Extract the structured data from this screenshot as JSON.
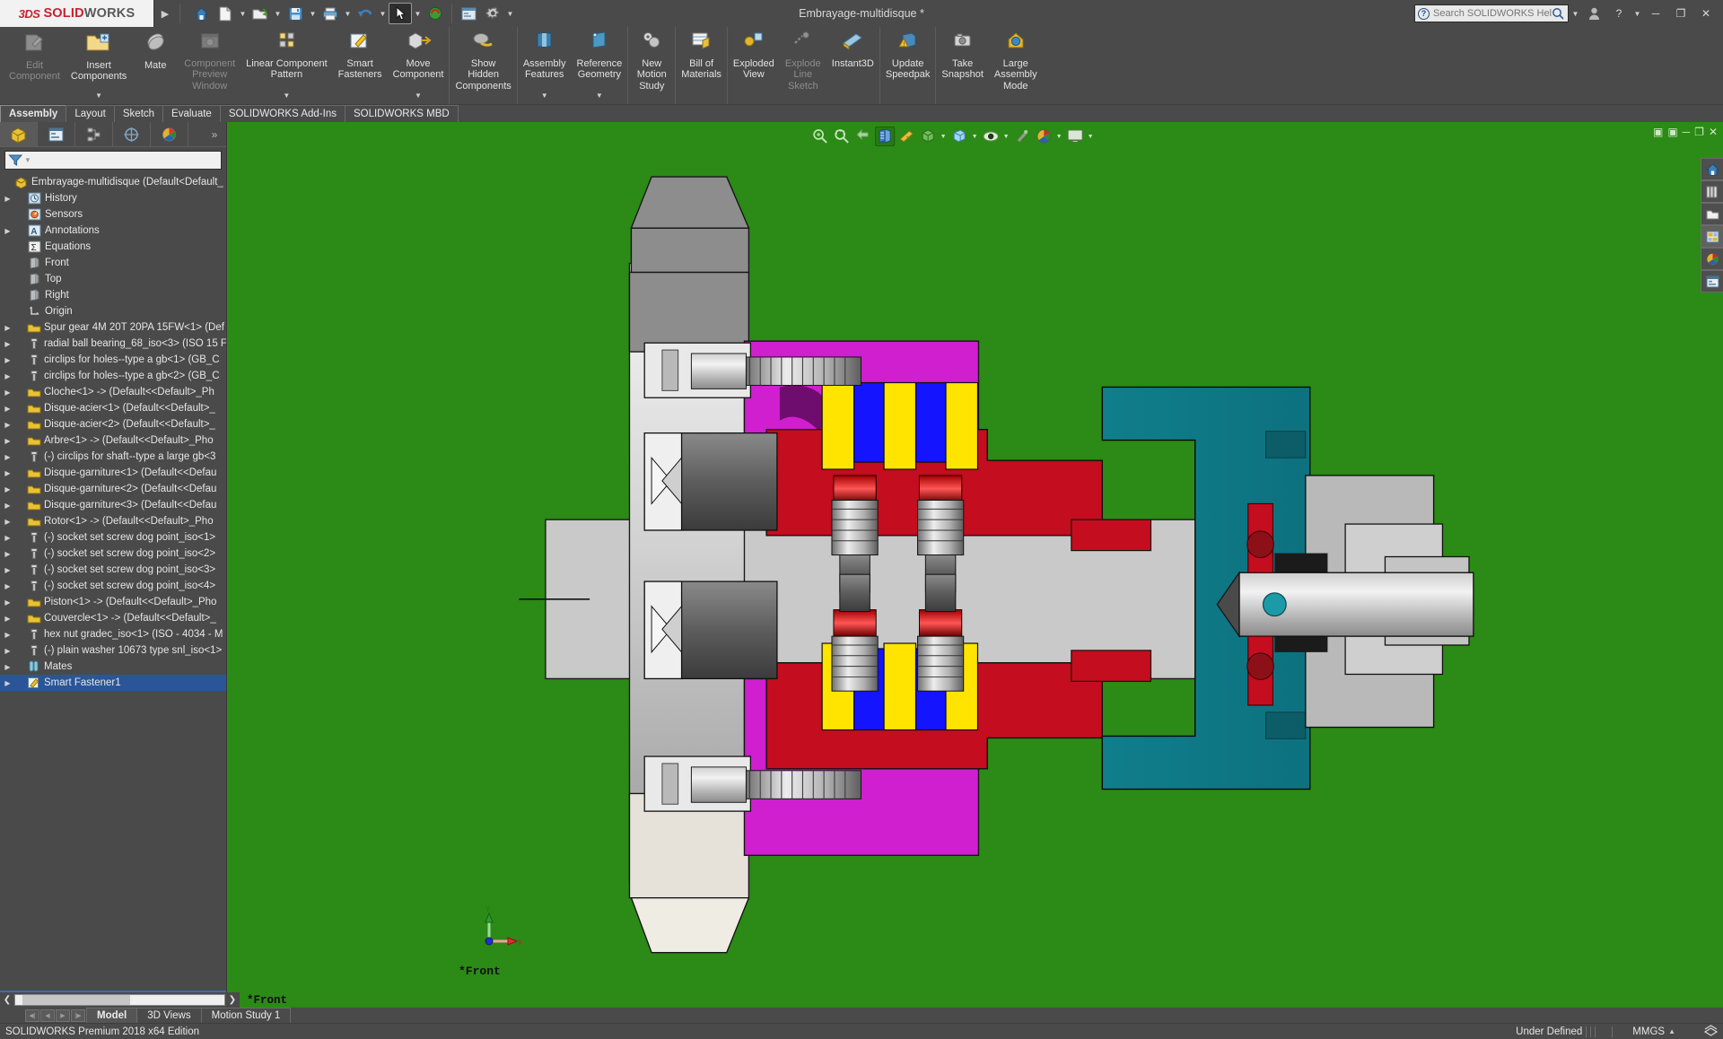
{
  "titlebar": {
    "logo_3ds": "3DS",
    "logo_solid": "SOLID",
    "logo_works": "WORKS",
    "document_title": "Embrayage-multidisque *",
    "search_placeholder": "Search SOLIDWORKS Help",
    "quick_access": [
      {
        "name": "home-icon",
        "label": "Home"
      },
      {
        "name": "new-document-icon",
        "label": "New"
      },
      {
        "name": "open-document-icon",
        "label": "Open"
      },
      {
        "name": "save-icon",
        "label": "Save"
      },
      {
        "name": "print-icon",
        "label": "Print"
      },
      {
        "name": "undo-icon",
        "label": "Undo"
      },
      {
        "name": "select-cursor-icon",
        "label": "Select"
      },
      {
        "name": "rebuild-icon",
        "label": "Rebuild"
      },
      {
        "name": "options-window-icon",
        "label": "Options Window"
      },
      {
        "name": "settings-gear-icon",
        "label": "Options"
      }
    ],
    "window_controls": [
      {
        "name": "user-account-icon",
        "glyph": "●"
      },
      {
        "name": "help-icon",
        "glyph": "?"
      },
      {
        "name": "minimize-icon",
        "glyph": "—"
      },
      {
        "name": "restore-icon",
        "glyph": "❐"
      },
      {
        "name": "close-icon",
        "glyph": "✕"
      }
    ]
  },
  "ribbon": {
    "groups": [
      {
        "buttons": [
          {
            "label": "Edit\nComponent",
            "icon": "edit-component-icon",
            "disabled": true,
            "caret": false
          },
          {
            "label": "Insert\nComponents",
            "icon": "insert-components-icon",
            "disabled": false,
            "caret": true
          },
          {
            "label": "Mate",
            "icon": "mate-icon",
            "disabled": false,
            "caret": false
          },
          {
            "label": "Component\nPreview\nWindow",
            "icon": "component-preview-window-icon",
            "disabled": true,
            "caret": false
          },
          {
            "label": "Linear Component\nPattern",
            "icon": "linear-component-pattern-icon",
            "disabled": false,
            "caret": true
          },
          {
            "label": "Smart\nFasteners",
            "icon": "smart-fasteners-icon",
            "disabled": false,
            "caret": false
          },
          {
            "label": "Move\nComponent",
            "icon": "move-component-icon",
            "disabled": false,
            "caret": true
          }
        ]
      },
      {
        "buttons": [
          {
            "label": "Show\nHidden\nComponents",
            "icon": "show-hidden-components-icon",
            "disabled": false,
            "caret": false
          }
        ]
      },
      {
        "buttons": [
          {
            "label": "Assembly\nFeatures",
            "icon": "assembly-features-icon",
            "disabled": false,
            "caret": true
          },
          {
            "label": "Reference\nGeometry",
            "icon": "reference-geometry-icon",
            "disabled": false,
            "caret": true
          }
        ]
      },
      {
        "buttons": [
          {
            "label": "New\nMotion\nStudy",
            "icon": "new-motion-study-icon",
            "disabled": false,
            "caret": false
          }
        ]
      },
      {
        "buttons": [
          {
            "label": "Bill of\nMaterials",
            "icon": "bill-of-materials-icon",
            "disabled": false,
            "caret": false
          }
        ]
      },
      {
        "buttons": [
          {
            "label": "Exploded\nView",
            "icon": "exploded-view-icon",
            "disabled": false,
            "caret": false
          },
          {
            "label": "Explode\nLine\nSketch",
            "icon": "explode-line-sketch-icon",
            "disabled": true,
            "caret": false
          },
          {
            "label": "Instant3D",
            "icon": "instant3d-icon",
            "disabled": false,
            "caret": false
          }
        ]
      },
      {
        "buttons": [
          {
            "label": "Update\nSpeedpak",
            "icon": "update-speedpak-icon",
            "disabled": false,
            "caret": false
          }
        ]
      },
      {
        "buttons": [
          {
            "label": "Take\nSnapshot",
            "icon": "take-snapshot-icon",
            "disabled": false,
            "caret": false
          },
          {
            "label": "Large\nAssembly\nMode",
            "icon": "large-assembly-mode-icon",
            "disabled": false,
            "caret": false
          }
        ]
      }
    ],
    "tabs": [
      {
        "label": "Assembly",
        "active": true
      },
      {
        "label": "Layout",
        "active": false
      },
      {
        "label": "Sketch",
        "active": false
      },
      {
        "label": "Evaluate",
        "active": false
      },
      {
        "label": "SOLIDWORKS Add-Ins",
        "active": false
      },
      {
        "label": "SOLIDWORKS MBD",
        "active": false
      }
    ]
  },
  "feature_manager": {
    "tabs": [
      {
        "name": "feature-manager-design-tree-tab",
        "active": true
      },
      {
        "name": "property-manager-tab",
        "active": false
      },
      {
        "name": "configuration-manager-tab",
        "active": false
      },
      {
        "name": "dimxpert-manager-tab",
        "active": false
      },
      {
        "name": "display-manager-tab",
        "active": false
      }
    ],
    "filter_placeholder": "",
    "tree": [
      {
        "label": "Embrayage-multidisque  (Default<Default_",
        "icon": "assembly-icon",
        "indent": 0,
        "arrow": false
      },
      {
        "label": "History",
        "icon": "history-icon",
        "indent": 1,
        "arrow": true
      },
      {
        "label": "Sensors",
        "icon": "sensors-icon",
        "indent": 1,
        "arrow": false
      },
      {
        "label": "Annotations",
        "icon": "annotations-icon",
        "indent": 1,
        "arrow": true
      },
      {
        "label": "Equations",
        "icon": "equations-icon",
        "indent": 1,
        "arrow": false
      },
      {
        "label": "Front",
        "icon": "plane-icon",
        "indent": 1,
        "arrow": false
      },
      {
        "label": "Top",
        "icon": "plane-icon",
        "indent": 1,
        "arrow": false
      },
      {
        "label": "Right",
        "icon": "plane-icon",
        "indent": 1,
        "arrow": false
      },
      {
        "label": "Origin",
        "icon": "origin-icon",
        "indent": 1,
        "arrow": false
      },
      {
        "label": "Spur gear 4M 20T 20PA 15FW<1>  (Def",
        "icon": "part-icon",
        "indent": 1,
        "arrow": true
      },
      {
        "label": "radial ball bearing_68_iso<3>  (ISO 15 F",
        "icon": "fastener-icon",
        "indent": 1,
        "arrow": true
      },
      {
        "label": "circlips for holes--type a gb<1>  (GB_C",
        "icon": "fastener-icon",
        "indent": 1,
        "arrow": true
      },
      {
        "label": "circlips for holes--type a gb<2>  (GB_C",
        "icon": "fastener-icon",
        "indent": 1,
        "arrow": true
      },
      {
        "label": "Cloche<1> ->  (Default<<Default>_Ph",
        "icon": "part-icon",
        "indent": 1,
        "arrow": true
      },
      {
        "label": "Disque-acier<1>  (Default<<Default>_",
        "icon": "part-icon",
        "indent": 1,
        "arrow": true
      },
      {
        "label": "Disque-acier<2>  (Default<<Default>_",
        "icon": "part-icon",
        "indent": 1,
        "arrow": true
      },
      {
        "label": "Arbre<1> ->  (Default<<Default>_Pho",
        "icon": "part-icon",
        "indent": 1,
        "arrow": true
      },
      {
        "label": "(-) circlips for shaft--type a large gb<3",
        "icon": "fastener-icon",
        "indent": 1,
        "arrow": true
      },
      {
        "label": "Disque-garniture<1>  (Default<<Defau",
        "icon": "part-icon",
        "indent": 1,
        "arrow": true
      },
      {
        "label": "Disque-garniture<2>  (Default<<Defau",
        "icon": "part-icon",
        "indent": 1,
        "arrow": true
      },
      {
        "label": "Disque-garniture<3>  (Default<<Defau",
        "icon": "part-icon",
        "indent": 1,
        "arrow": true
      },
      {
        "label": "Rotor<1> ->  (Default<<Default>_Pho",
        "icon": "part-icon",
        "indent": 1,
        "arrow": true
      },
      {
        "label": "(-) socket set screw dog point_iso<1>",
        "icon": "fastener-icon",
        "indent": 1,
        "arrow": true
      },
      {
        "label": "(-) socket set screw dog point_iso<2>",
        "icon": "fastener-icon",
        "indent": 1,
        "arrow": true
      },
      {
        "label": "(-) socket set screw dog point_iso<3>",
        "icon": "fastener-icon",
        "indent": 1,
        "arrow": true
      },
      {
        "label": "(-) socket set screw dog point_iso<4>",
        "icon": "fastener-icon",
        "indent": 1,
        "arrow": true
      },
      {
        "label": "Piston<1> ->  (Default<<Default>_Pho",
        "icon": "part-icon",
        "indent": 1,
        "arrow": true
      },
      {
        "label": "Couvercle<1> ->  (Default<<Default>_",
        "icon": "part-icon",
        "indent": 1,
        "arrow": true
      },
      {
        "label": "hex nut gradec_iso<1>  (ISO - 4034 - M",
        "icon": "fastener-icon",
        "indent": 1,
        "arrow": true
      },
      {
        "label": "(-) plain washer 10673 type snl_iso<1>",
        "icon": "fastener-icon",
        "indent": 1,
        "arrow": true
      },
      {
        "label": "Mates",
        "icon": "mates-folder-icon",
        "indent": 1,
        "arrow": true
      },
      {
        "label": "Smart Fastener1",
        "icon": "smart-fastener-icon",
        "indent": 1,
        "arrow": true,
        "selected": true
      }
    ]
  },
  "graphics": {
    "view_label": "*Front",
    "background_color": "#2c8a16",
    "triad": {
      "x_label": "X",
      "y_label": "Y",
      "x_color": "#e03030",
      "y_color": "#2e9e2e"
    },
    "hud_buttons": [
      {
        "name": "zoom-to-fit-icon",
        "active": false
      },
      {
        "name": "zoom-to-area-icon",
        "active": false
      },
      {
        "name": "previous-view-icon",
        "active": false
      },
      {
        "name": "section-view-icon",
        "active": true
      },
      {
        "name": "view-orientation-icon",
        "active": false,
        "caret": false
      },
      {
        "name": "display-style-icon",
        "active": false,
        "caret": true
      },
      {
        "name": "hide-show-items-icon",
        "active": false,
        "caret": true
      },
      {
        "name": "edit-appearance-icon",
        "active": false,
        "caret": true
      },
      {
        "name": "apply-scene-icon",
        "active": false,
        "caret": true
      },
      {
        "name": "view-settings-icon",
        "active": false,
        "caret": true
      }
    ],
    "window_ctrl": [
      {
        "name": "restore-viewport-icon",
        "glyph": "▣"
      },
      {
        "name": "tile-viewport-icon",
        "glyph": "▣"
      },
      {
        "name": "minimize-viewport-icon",
        "glyph": "—"
      },
      {
        "name": "maximize-viewport-icon",
        "glyph": "❐"
      },
      {
        "name": "close-viewport-icon",
        "glyph": "✕"
      }
    ]
  },
  "task_pane": [
    {
      "name": "solidworks-resources-icon",
      "active": false
    },
    {
      "name": "design-library-icon",
      "active": false
    },
    {
      "name": "file-explorer-icon",
      "active": false
    },
    {
      "name": "view-palette-icon",
      "active": true
    },
    {
      "name": "appearances-scenes-icon",
      "active": false
    },
    {
      "name": "custom-properties-icon",
      "active": false
    }
  ],
  "bottom": {
    "document_tabs": [
      {
        "label": "Model",
        "active": true
      },
      {
        "label": "3D Views",
        "active": false
      },
      {
        "label": "Motion Study 1",
        "active": false
      }
    ],
    "status_left": "SOLIDWORKS Premium 2018 x64 Edition",
    "status_defined": "Under Defined",
    "status_units": "MMGS",
    "units_caret": "▲"
  }
}
